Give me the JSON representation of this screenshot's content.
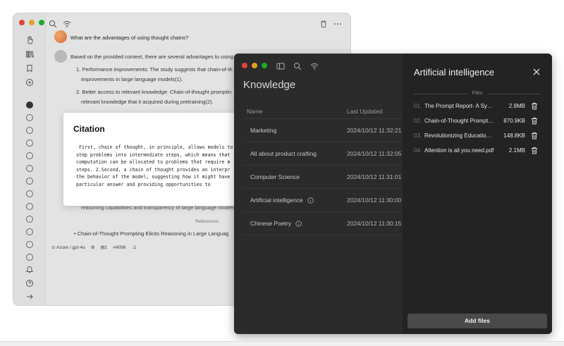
{
  "chat": {
    "question": "What are the advantages of using thought chains?",
    "answer_intro": "Based on the provided context, there are several advantages to using",
    "points": [
      "1. Performance improvements: The study suggests that chain-of-th",
      "improvements in large language models(1).",
      "2. Better access to relevant knowledge: Chain-of-thought promptin",
      "relevant knowledge that it acquired during pretraining(2)."
    ],
    "hidden_line": "reasoning capabilities and transparency of large language models.",
    "references_label": "References",
    "reference_item": "Chain-of-Thought Prompting Elicits Reasoning in Large Languag",
    "footer": {
      "model": "Azure / gpt-4o",
      "count_a": "1",
      "tokens": "4096",
      "count_b": "1"
    },
    "colors": {
      "close": "#e0443e",
      "minimize": "#dea123",
      "zoom": "#1aab29"
    }
  },
  "citation": {
    "title": "Citation",
    "body": " First, chain of thought, in principle, allows models to\nstep problems into intermediate steps, which means that\ncomputation can be allocated to problems that require m\nsteps. 2.Second, a chain of thought provides an interpr\nthe behavior of the model, suggesting how it might have\nparticular answer and providing opportunities to"
  },
  "knowledge": {
    "title": "Knowledge",
    "col_name": "Name",
    "col_updated": "Last Updated",
    "rows": [
      {
        "name": "Marketing",
        "date": "2024/10/12 11:32:21",
        "info": false
      },
      {
        "name": "All about product crafting",
        "date": "2024/10/12 11:32:05",
        "info": false
      },
      {
        "name": "Computer Science",
        "date": "2024/10/12 11:31:01",
        "info": false
      },
      {
        "name": "Artificial intelligence",
        "date": "2024/10/12 11:30:00",
        "info": true
      },
      {
        "name": "Chinese Poetry",
        "date": "2024/10/12 11:30:15",
        "info": true
      }
    ]
  },
  "panel": {
    "title": "Artificial intelligence",
    "files_label": "Files",
    "files": [
      {
        "idx": "01.",
        "name": "The Prompt Report- A Systematic Survey",
        "size": "2.9MB"
      },
      {
        "idx": "02.",
        "name": "Chain-of-Thought Prompting Elicits",
        "size": "870.9KB"
      },
      {
        "idx": "03.",
        "name": "Revolutionizing Education with AI",
        "size": "148.8KB"
      },
      {
        "idx": "04.",
        "name": "Attention is all you need.pdf",
        "size": "2.1MB"
      }
    ],
    "add_files_label": "Add files"
  }
}
